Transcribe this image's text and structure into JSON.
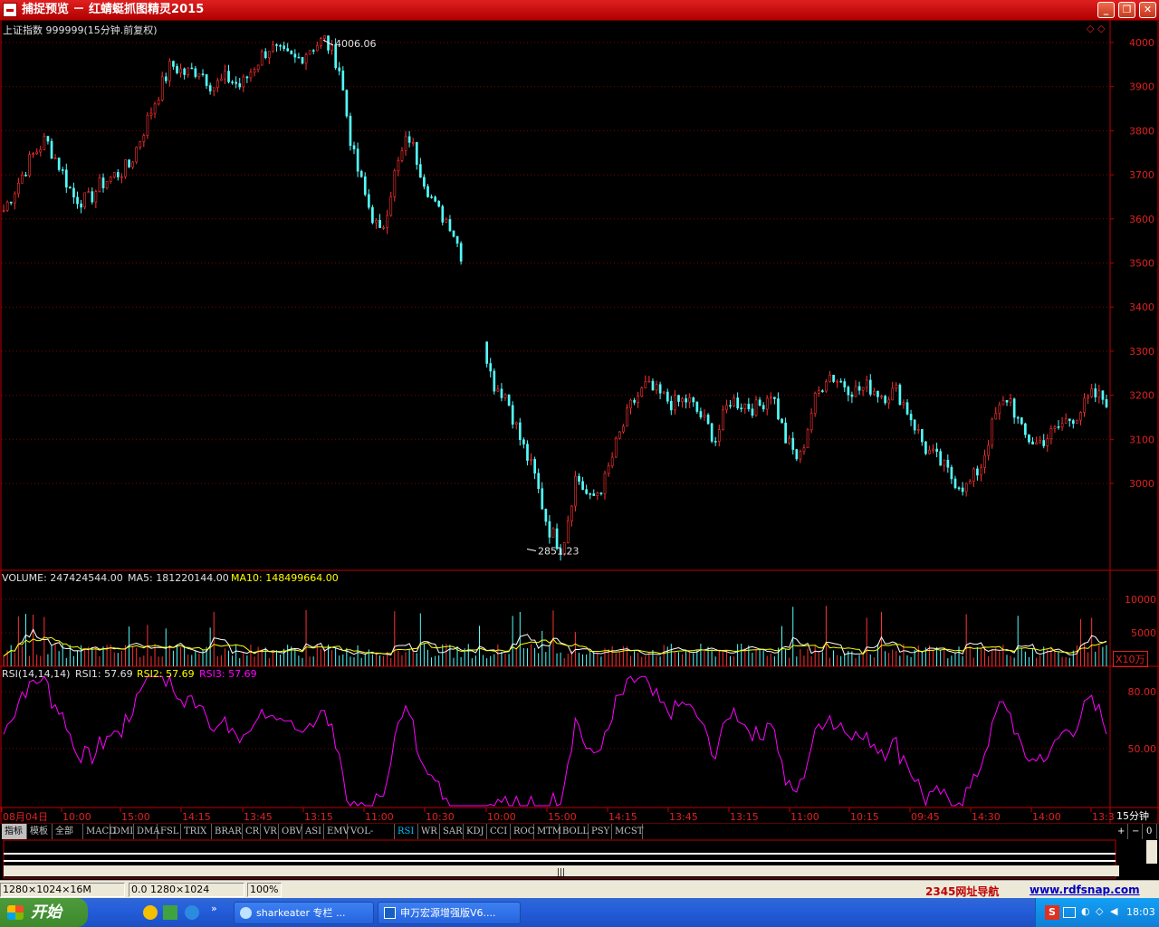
{
  "window": {
    "title": "捕捉预览 － 红蜻蜓抓图精灵2015",
    "buttons": [
      "_",
      "❐",
      "✕"
    ]
  },
  "main_panel": {
    "header": "上证指数 999999(15分钟.前复权)",
    "high_label": "4006.06",
    "low_label": "2851.23",
    "price_axis": [
      "4000",
      "3900",
      "3800",
      "3700",
      "3600",
      "3500",
      "3400",
      "3300",
      "3200",
      "3100",
      "3000"
    ]
  },
  "volume_panel": {
    "label": "VOLUME: 247424544.00",
    "ma5": "MA5: 181220144.00",
    "ma10": "MA10: 148499664.00",
    "axis": [
      "10000",
      "5000"
    ],
    "unit": "X10万"
  },
  "rsi_panel": {
    "label": "RSI(14,14,14)",
    "rsi1": "RSI1: 57.69",
    "rsi2": "RSI2: 57.69",
    "rsi3": "RSI3: 57.69",
    "axis": [
      "80.00",
      "50.00"
    ]
  },
  "time_axis": [
    "08月04日",
    "10:00",
    "15:00",
    "14:15",
    "13:45",
    "13:15",
    "11:00",
    "10:30",
    "10:00",
    "15:00",
    "14:15",
    "13:45",
    "13:15",
    "11:00",
    "10:15",
    "09:45",
    "14:30",
    "14:00",
    "13:3"
  ],
  "period_label": "15分钟",
  "indicator_tabs": [
    "指标",
    "模板",
    "全部",
    "MACD",
    "DMI",
    "DMA",
    "FSL",
    "TRIX",
    "BRAR",
    "CR",
    "VR",
    "OBV",
    "ASI",
    "EMV",
    "VOL-TDX",
    "RSI",
    "WR",
    "SAR",
    "KDJ",
    "CCI",
    "ROC",
    "MTM",
    "BOLL",
    "PSY",
    "MCST"
  ],
  "active_tab": "RSI",
  "statusbar": {
    "resolution": "1280×1024×16M",
    "coords": "0.0 1280×1024",
    "zoom": "100%",
    "link1": "2345网址导航",
    "link2": "www.rdfsnap.com"
  },
  "taskbar": {
    "start": "开始",
    "tasks": [
      "sharkeater 专栏 ...",
      "申万宏源增强版V6...."
    ],
    "clock": "18:03"
  },
  "colors": {
    "up": "#ff3232",
    "down": "#54fcfc",
    "grid": "#800000",
    "ma5": "#ffffff",
    "ma10": "#ffff00",
    "rsi": "#ff00ff"
  },
  "chart_data": {
    "type": "candlestick",
    "title": "上证指数 999999(15分钟.前复权)",
    "ylim": [
      2851.23,
      4006.06
    ],
    "close_path": [
      3620,
      3680,
      3740,
      3780,
      3720,
      3650,
      3640,
      3680,
      3700,
      3720,
      3800,
      3880,
      3950,
      3930,
      3940,
      3900,
      3920,
      3900,
      3950,
      3990,
      3970,
      3960,
      3990,
      4006,
      3950,
      3750,
      3640,
      3560,
      3700,
      3790,
      3700,
      3620,
      3590,
      3500,
      3390,
      3230,
      3200,
      3100,
      3020,
      2900,
      2851,
      3020,
      2960,
      3000,
      3100,
      3180,
      3220,
      3200,
      3180,
      3190,
      3150,
      3100,
      3190,
      3180,
      3170,
      3210,
      3100,
      3050,
      3180,
      3250,
      3230,
      3210,
      3220,
      3200,
      3210,
      3150,
      3080,
      3050,
      3010,
      2990,
      3040,
      3150,
      3200,
      3110,
      3090,
      3110,
      3140,
      3160,
      3200,
      3190
    ]
  }
}
